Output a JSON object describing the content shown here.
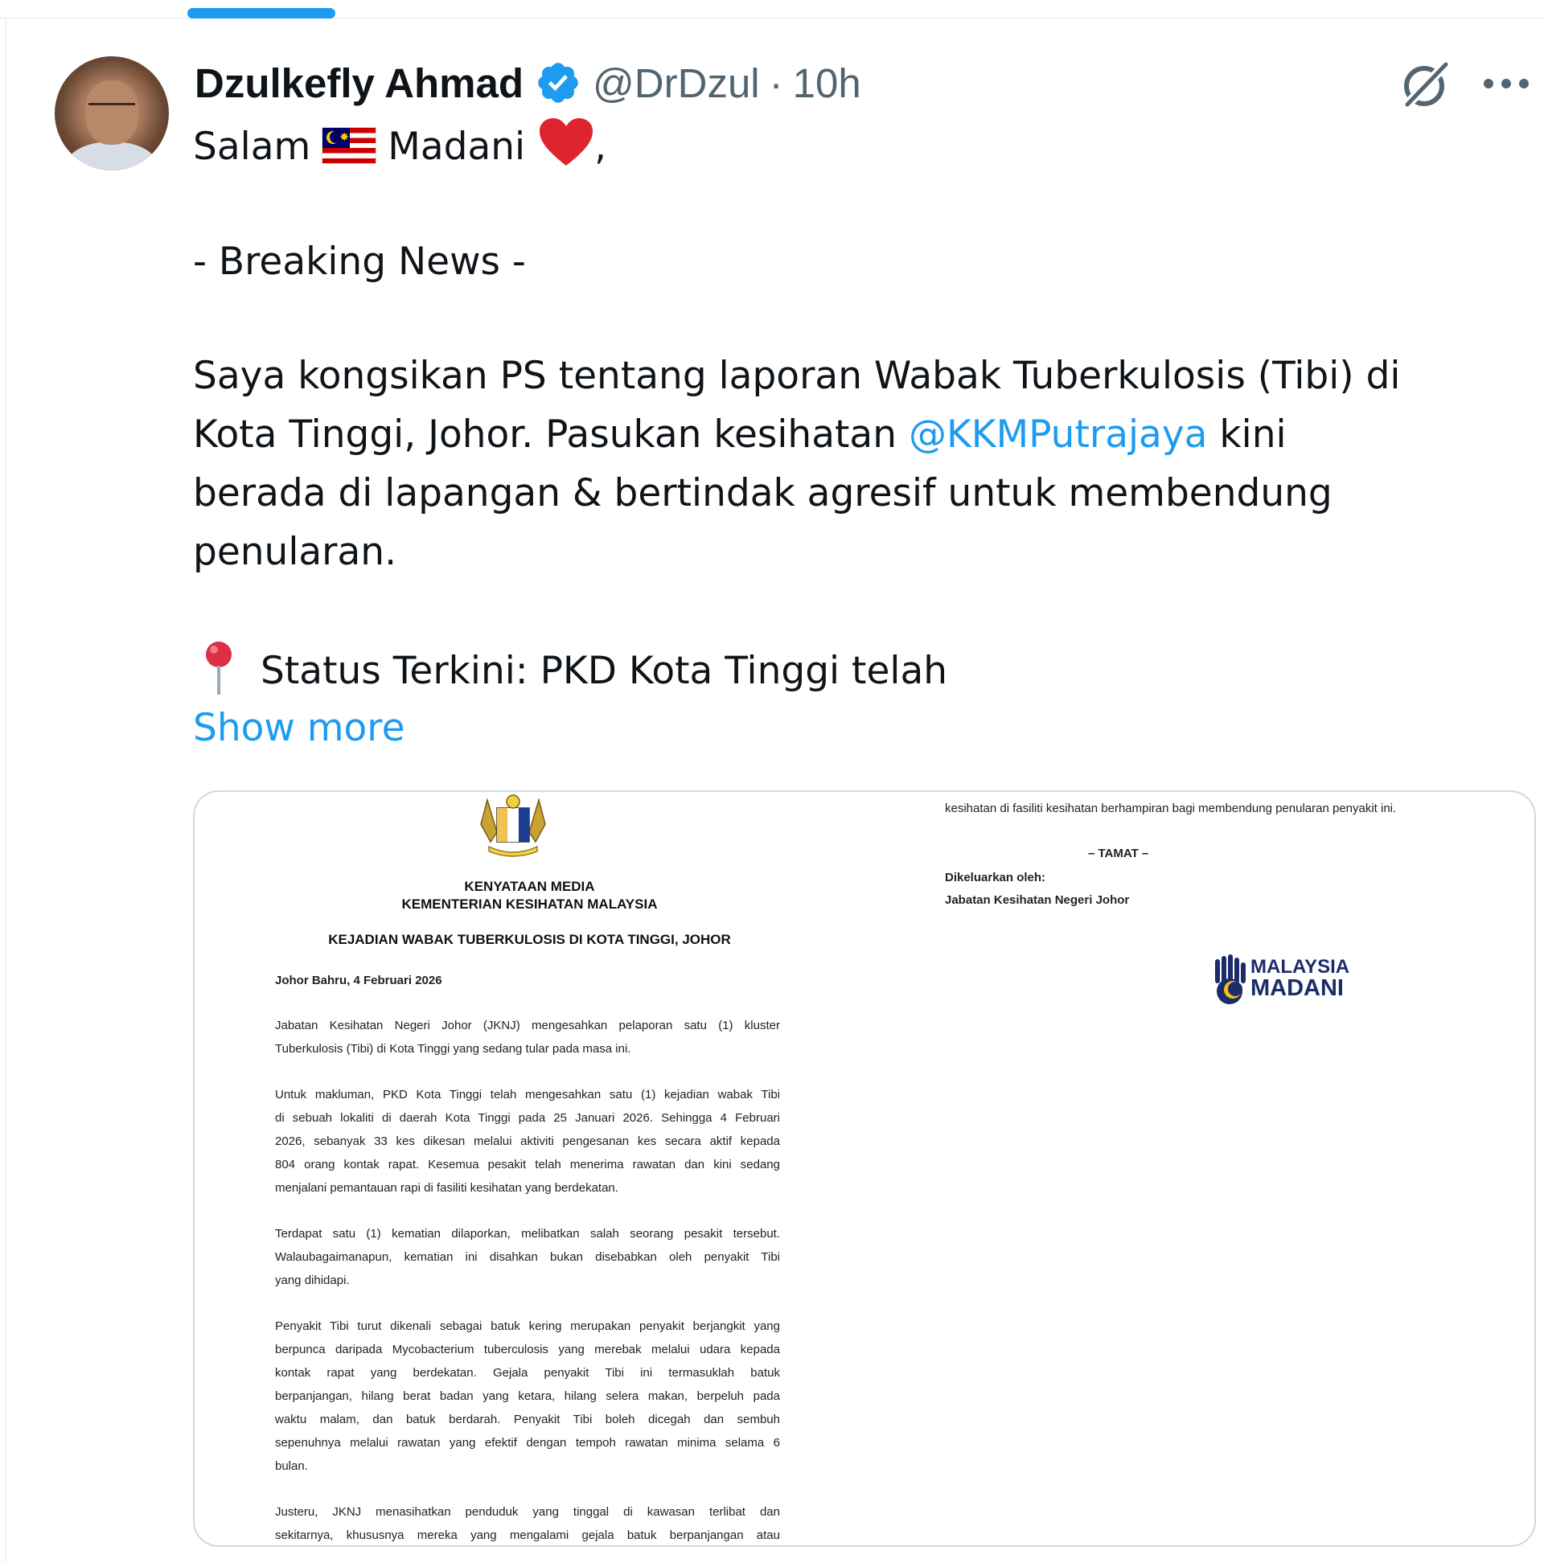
{
  "tweet": {
    "author_name": "Dzulkefly Ahmad",
    "handle": "@DrDzul",
    "separator": "·",
    "time": "10h",
    "line1_a": "Salam",
    "line1_b": "Madani",
    "line1_c": ",",
    "breaking": "- Breaking News -",
    "p1_line1": "Saya kongsikan PS tentang laporan Wabak Tuberkulosis (Tibi) di",
    "p1_line2_a": "Kota Tinggi, Johor. Pasukan kesihatan ",
    "mention": "@KKMPutrajaya",
    "p1_line2_b": " kini",
    "p1_line3": "berada di lapangan & bertindak agresif untuk membendung",
    "p1_line4": "penularan.",
    "status_line": "Status Terkini: PKD Kota Tinggi telah",
    "show_more": "Show more"
  },
  "icons": {
    "verified": "verified-badge-icon",
    "grok": "grok-icon",
    "more": "more-options-icon",
    "flag": "malaysia-flag-emoji",
    "heart": "red-heart-emoji",
    "pin": "round-pushpin-emoji"
  },
  "colors": {
    "accent": "#1d9bf0",
    "text": "#0f1419",
    "secondary": "#536471",
    "heart": "#e0242f"
  },
  "document": {
    "page1": {
      "title1": "KENYATAAN  MEDIA",
      "title2": "KEMENTERIAN KESIHATAN MALAYSIA",
      "title3": "KEJADIAN WABAK TUBERKULOSIS DI KOTA TINGGI, JOHOR",
      "dateline": "Johor Bahru, 4 Februari 2026",
      "para1": [
        "Jabatan Kesihatan Negeri Johor (JKNJ) mengesahkan pelaporan satu (1) kluster",
        "Tuberkulosis (Tibi) di Kota Tinggi yang sedang tular pada masa ini."
      ],
      "para2": [
        "Untuk makluman, PKD Kota Tinggi telah mengesahkan satu (1) kejadian wabak Tibi",
        "di sebuah lokaliti di daerah Kota Tinggi pada 25 Januari 2026. Sehingga 4 Februari",
        "2026, sebanyak 33 kes dikesan melalui aktiviti pengesanan kes secara aktif kepada",
        "804 orang kontak rapat. Kesemua pesakit telah menerima rawatan dan kini sedang",
        "menjalani pemantauan rapi di fasiliti kesihatan yang berdekatan."
      ],
      "para3": [
        "Terdapat satu (1) kematian dilaporkan, melibatkan salah seorang pesakit tersebut.",
        "Walaubagaimanapun, kematian ini disahkan bukan disebabkan oleh penyakit Tibi",
        "yang dihidapi."
      ],
      "para4": [
        "Penyakit Tibi turut dikenali sebagai batuk kering merupakan penyakit berjangkit yang",
        "berpunca daripada Mycobacterium tuberculosis yang merebak melalui udara kepada",
        "kontak rapat yang berdekatan. Gejala penyakit Tibi ini termasuklah batuk",
        "berpanjangan, hilang berat badan yang ketara, hilang selera makan, berpeluh pada",
        "waktu malam, dan batuk berdarah. Penyakit Tibi boleh dicegah dan sembuh",
        "sepenuhnya melalui rawatan yang efektif dengan tempoh rawatan minima selama 6",
        "bulan."
      ],
      "para5": [
        "Justeru, JKNJ menasihatkan penduduk yang tinggal di kawasan terlibat dan",
        "sekitarnya, khususnya mereka yang mengalami gejala batuk berpanjangan atau"
      ]
    },
    "page2": {
      "line1": "kesihatan di fasiliti kesihatan berhampiran bagi membendung penularan penyakit ini.",
      "end": "– TAMAT –",
      "issued_by": "Dikeluarkan oleh:",
      "issuer": "Jabatan Kesihatan Negeri Johor",
      "logo_line1": "MALAYSIA",
      "logo_line2": "MADANI"
    }
  }
}
